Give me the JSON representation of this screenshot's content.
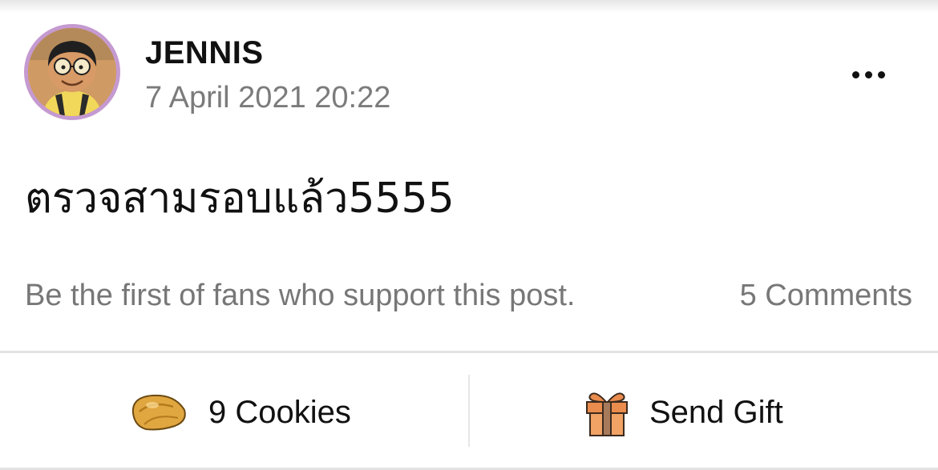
{
  "post": {
    "author": "JENNIS",
    "date": "7 April 2021 20:22",
    "body": "ตรวจสามรอบแล้ว5555"
  },
  "stats": {
    "support_text": "Be the first of fans who support this post.",
    "comments": "5 Comments"
  },
  "actions": {
    "cookies_label": "9 Cookies",
    "gift_label": "Send Gift"
  },
  "icons": {
    "more": "more-options-icon",
    "cookie": "fortune-cookie-icon",
    "gift": "gift-box-icon"
  },
  "colors": {
    "avatar_ring": "#c59ad0",
    "secondary_text": "#7b7b7b",
    "divider": "#e3e3e3",
    "cookie": "#e0a640",
    "gift": "#e98c4d"
  }
}
